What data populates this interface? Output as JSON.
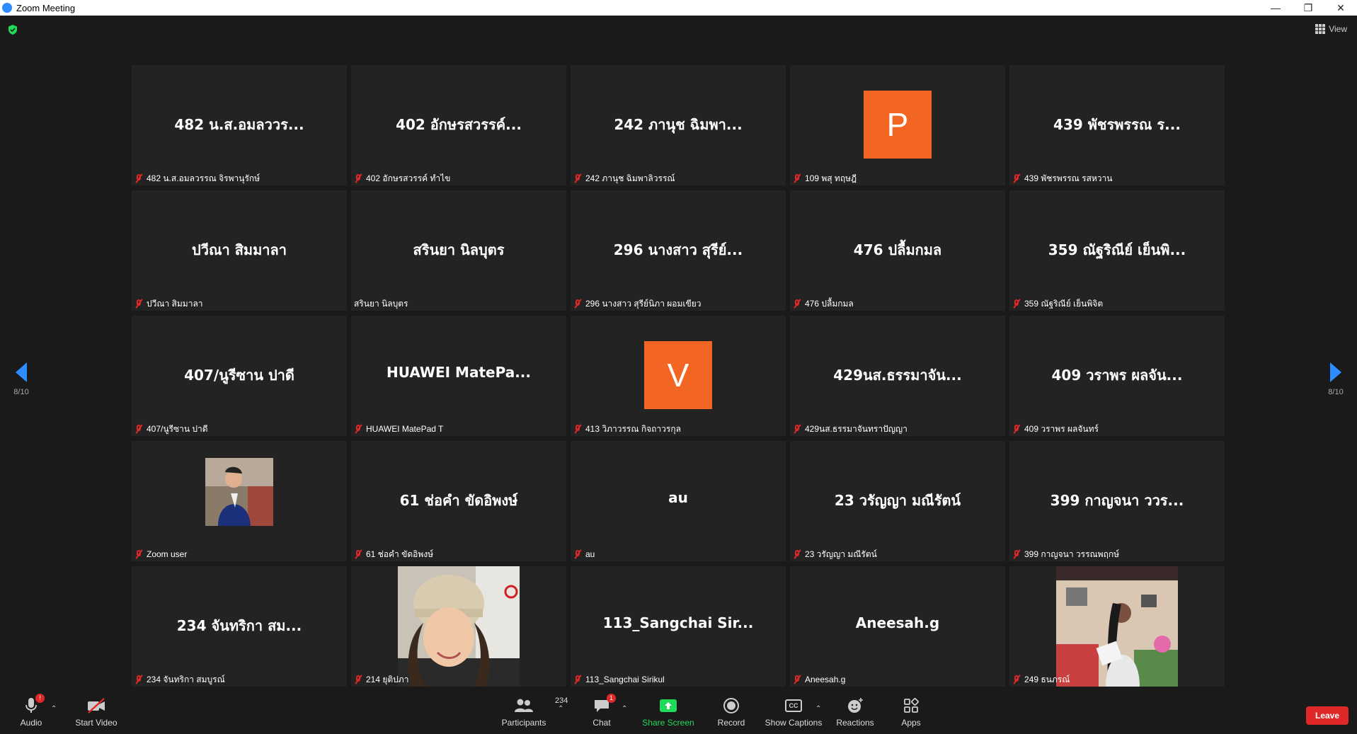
{
  "window": {
    "title": "Zoom Meeting",
    "minimize": "—",
    "restore": "❐",
    "close": "✕"
  },
  "view_label": "View",
  "pagination": {
    "left": "8/10",
    "right": "8/10"
  },
  "tiles": [
    {
      "big": "482 น.ส.อมลววร...",
      "name": "482 น.ส.อมลวรรณ จิรพานุรักษ์",
      "muted": true
    },
    {
      "big": "402 อักษรสวรรค์...",
      "name": "402 อักษรสวรรค์ ทำไข",
      "muted": true
    },
    {
      "big": "242 ภานุช ฉิมพา...",
      "name": "242 ภานุช ฉิมพาลิวรรณ์",
      "muted": true
    },
    {
      "avatar_letter": "P",
      "name": "109 พสุ ทฤษฎี",
      "muted": true
    },
    {
      "big": "439 พัชรพรรณ ร...",
      "name": "439 พัชรพรรณ รสหวาน",
      "muted": true
    },
    {
      "big": "ปวีณา สิมมาลา",
      "name": "ปวีณา สิมมาลา",
      "muted": true
    },
    {
      "big": "สรินยา นิลบุตร",
      "name": "สรินยา นิลบุตร",
      "muted": false
    },
    {
      "big": "296 นางสาว สุรีย์...",
      "name": "296 นางสาว สุรีย์นิภา ผอมเขียว",
      "muted": true
    },
    {
      "big": "476 ปลื้มกมล",
      "name": "476 ปลื้มกมล",
      "muted": true
    },
    {
      "big": "359 ณัฐริณีย์ เย็นพิ...",
      "name": "359 ณัฐริณีย์ เย็นพิจิต",
      "muted": true
    },
    {
      "big": "407/นูรีซาน ปาดี",
      "name": "407/นูรีซาน ปาดี",
      "muted": true
    },
    {
      "big": "HUAWEI MatePa...",
      "name": "HUAWEI MatePad T",
      "muted": true
    },
    {
      "avatar_letter": "V",
      "name": "413 วิภาวรรณ กิจถาวรกุล",
      "muted": true
    },
    {
      "big": "429นส.ธรรมาจัน...",
      "name": "429นส.ธรรมาจันทราปัญญา",
      "muted": true
    },
    {
      "big": "409 วราพร ผลจัน...",
      "name": "409 วราพร ผลจันทร์",
      "muted": true
    },
    {
      "photo": "man",
      "name": "Zoom user",
      "muted": true
    },
    {
      "big": "61  ช่อคำ  ขัดอิพงษ์",
      "name": "61  ช่อคำ  ขัดอิพงษ์",
      "muted": true
    },
    {
      "big": "au",
      "name": "au",
      "muted": true
    },
    {
      "big": "23 วรัญญา มณีรัตน์",
      "name": "23 วรัญญา มณีรัตน์",
      "muted": true
    },
    {
      "big": "399 กาญจนา ววร...",
      "name": "399 กาญจนา วรรณพฤกษ์",
      "muted": true
    },
    {
      "big": "234  จันทริกา  สม...",
      "name": "234  จันทริกา  สมบูรณ์",
      "muted": true
    },
    {
      "photo": "woman-hat",
      "name": "214 ยุติปภา",
      "muted": true
    },
    {
      "big": "113_Sangchai  Sir...",
      "name": "113_Sangchai Sirikul",
      "muted": true
    },
    {
      "big": "Aneesah.g",
      "name": "Aneesah.g",
      "muted": true
    },
    {
      "photo": "woman-room",
      "name": "249 ธนภรณ์",
      "muted": true
    }
  ],
  "toolbar": {
    "audio": "Audio",
    "audio_badge": "!",
    "start_video": "Start Video",
    "participants": "Participants",
    "participants_count": "234",
    "chat": "Chat",
    "chat_badge": "1",
    "share_screen": "Share Screen",
    "record": "Record",
    "show_captions": "Show Captions",
    "captions_icon": "CC",
    "reactions": "Reactions",
    "apps": "Apps",
    "leave": "Leave"
  },
  "colors": {
    "accent": "#2d8cff",
    "share_green": "#23d959",
    "leave_red": "#e02828",
    "avatar_orange": "#f26522"
  }
}
